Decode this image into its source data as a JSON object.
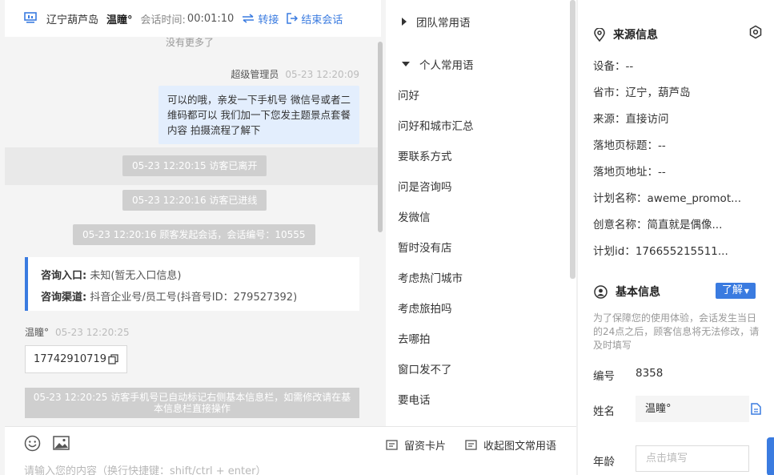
{
  "header": {
    "location": "辽宁葫芦岛",
    "visitor_name": "温瞳°",
    "session_label": "会话时间:",
    "session_time": "00:01:10",
    "transfer_label": "转接",
    "end_label": "结束会话"
  },
  "messages": {
    "no_more": "没有更多了",
    "agent_name": "超级管理员",
    "agent_time": "05-23 12:20:09",
    "agent_text": "可以的哦，亲发一下手机号 微信号或者二维码都可以 我们加一下您发主题景点套餐内容 拍摄流程了解下",
    "sys1": "05-23 12:20:15 访客已离开",
    "sys2": "05-23 12:20:16 访客已进线",
    "sys3": "05-23 12:20:16 顾客发起会话，会话编号：10555",
    "entry_label": "咨询入口:",
    "entry_value": "未知(暂无入口信息)",
    "channel_label": "咨询渠道:",
    "channel_value": "抖音企业号/员工号(抖音号ID：279527392)",
    "visitor_name": "温瞳°",
    "visitor_time": "05-23 12:20:25",
    "visitor_phone": "17742910719",
    "auto_note": "05-23 12:20:25 访客手机号已自动标记右侧基本信息栏，如需修改请在基本信息栏直接操作"
  },
  "composer": {
    "leave_card": "留资卡片",
    "collapse_phrases": "收起图文常用语",
    "placeholder": "请输入您的内容（换行快捷键：shift/ctrl + enter）"
  },
  "phrases": {
    "team_group": "团队常用语",
    "personal_group": "个人常用语",
    "items": [
      "问好",
      "问好和城市汇总",
      "要联系方式",
      "问是咨询吗",
      "发微信",
      "暂时没有店",
      "考虑热门城市",
      "考虑旅拍吗",
      "去哪拍",
      "窗口发不了",
      "要电话"
    ]
  },
  "source": {
    "title": "来源信息",
    "device": "设备：--",
    "province": "省市：辽宁，葫芦岛",
    "origin": "来源：直接访问",
    "landing_title": "落地页标题：--",
    "landing_url": "落地页地址：--",
    "plan_name": "计划名称：aweme_promot...",
    "creative_name": "创意名称：简直就是偶像...",
    "plan_id": "计划id：176655215511..."
  },
  "basic": {
    "title": "基本信息",
    "learn_more": "了解",
    "note": "为了保障您的使用体验，会话发生当日的24点之后，顾客信息将无法修改，请及时填写",
    "id_label": "编号",
    "id_value": "8358",
    "name_label": "姓名",
    "name_value": "温瞳°",
    "age_label": "年龄",
    "age_placeholder": "点击填写"
  }
}
